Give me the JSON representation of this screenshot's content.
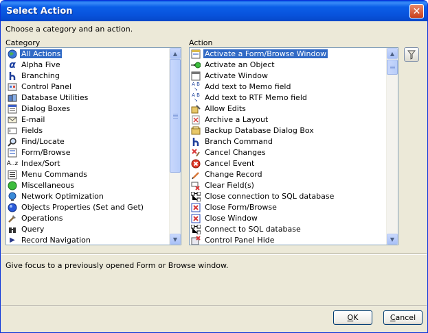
{
  "window": {
    "title": "Select Action",
    "close_glyph": "✕"
  },
  "instruction": "Choose a category and an action.",
  "category": {
    "label": "Category",
    "items": [
      {
        "label": "All Actions",
        "icon": "globe-icon",
        "selected": true
      },
      {
        "label": "Alpha Five",
        "icon": "alpha-icon"
      },
      {
        "label": "Branching",
        "icon": "branch-icon"
      },
      {
        "label": "Control Panel",
        "icon": "control-panel-icon"
      },
      {
        "label": "Database Utilities",
        "icon": "database-icon"
      },
      {
        "label": "Dialog Boxes",
        "icon": "dialog-icon"
      },
      {
        "label": "E-mail",
        "icon": "email-icon"
      },
      {
        "label": "Fields",
        "icon": "field-icon"
      },
      {
        "label": "Find/Locate",
        "icon": "find-icon"
      },
      {
        "label": "Form/Browse",
        "icon": "form-icon"
      },
      {
        "label": "Index/Sort",
        "icon": "sort-icon"
      },
      {
        "label": "Menu Commands",
        "icon": "menu-icon"
      },
      {
        "label": "Miscellaneous",
        "icon": "misc-icon"
      },
      {
        "label": "Network Optimization",
        "icon": "network-icon"
      },
      {
        "label": "Objects Properties (Set and Get)",
        "icon": "object-icon"
      },
      {
        "label": "Operations",
        "icon": "operations-icon"
      },
      {
        "label": "Query",
        "icon": "query-icon"
      },
      {
        "label": "Record Navigation",
        "icon": "navigation-icon"
      }
    ]
  },
  "action": {
    "label": "Action",
    "items": [
      {
        "label": "Activate a Form/Browse Window",
        "icon": "form-window-icon",
        "selected": true
      },
      {
        "label": "Activate an Object",
        "icon": "activate-object-icon"
      },
      {
        "label": "Activate Window",
        "icon": "window-icon"
      },
      {
        "label": "Add text to Memo field",
        "icon": "memo-text-icon"
      },
      {
        "label": "Add text to RTF Memo field",
        "icon": "rtf-memo-icon"
      },
      {
        "label": "Allow Edits",
        "icon": "edit-lock-icon"
      },
      {
        "label": "Archive a Layout",
        "icon": "archive-icon"
      },
      {
        "label": "Backup Database Dialog Box",
        "icon": "backup-icon"
      },
      {
        "label": "Branch Command",
        "icon": "branch-icon"
      },
      {
        "label": "Cancel Changes",
        "icon": "cancel-changes-icon"
      },
      {
        "label": "Cancel Event",
        "icon": "cancel-event-icon"
      },
      {
        "label": "Change Record",
        "icon": "pencil-icon"
      },
      {
        "label": "Clear Field(s)",
        "icon": "clear-field-icon"
      },
      {
        "label": "Close connection to SQL database",
        "icon": "sql-disconnect-icon"
      },
      {
        "label": "Close Form/Browse",
        "icon": "close-form-icon"
      },
      {
        "label": "Close Window",
        "icon": "close-window-icon"
      },
      {
        "label": "Connect to SQL database",
        "icon": "sql-connect-icon"
      },
      {
        "label": "Control Panel Hide",
        "icon": "control-panel-hide-icon"
      }
    ]
  },
  "filter_button": {
    "icon": "filter-icon"
  },
  "status_text": "Give focus to a previously opened Form or Browse window.",
  "buttons": {
    "ok": {
      "accel": "O",
      "rest": "K"
    },
    "cancel": {
      "accel": "C",
      "rest": "ancel"
    }
  },
  "colors": {
    "selection": "#316ac5",
    "dialog_bg": "#ece9d8",
    "title_blue": "#0853dc"
  }
}
